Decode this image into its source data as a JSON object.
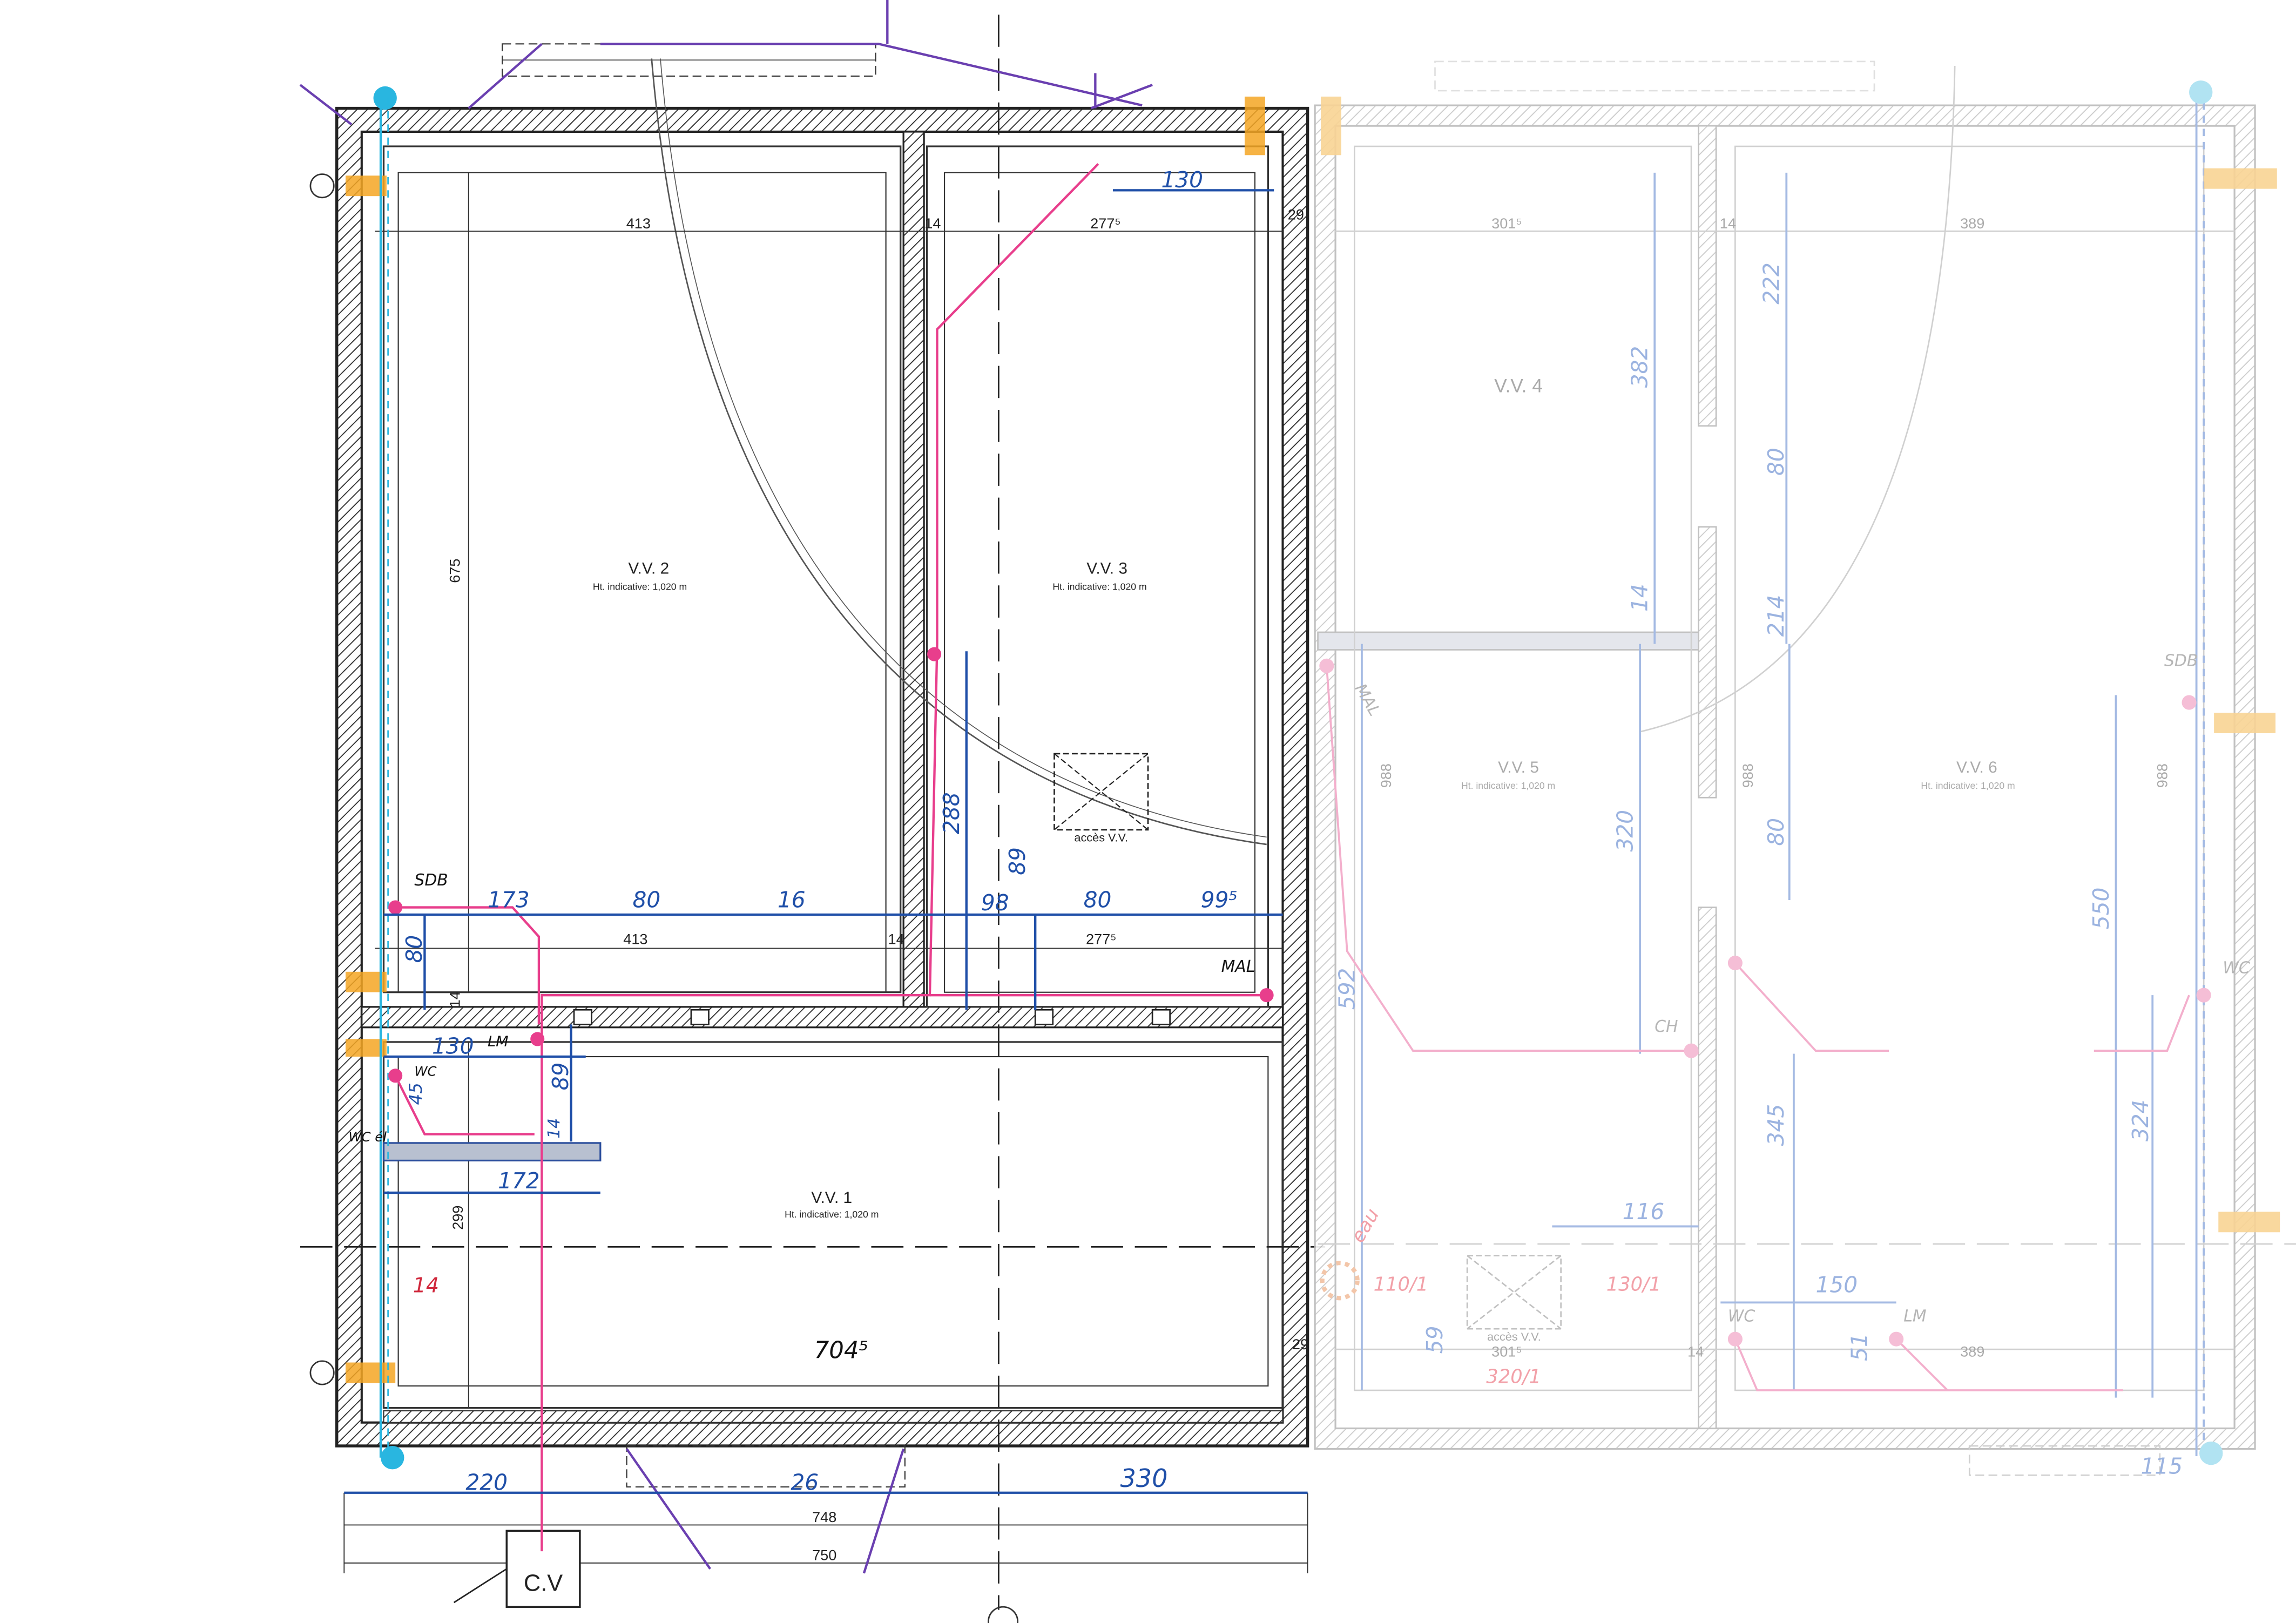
{
  "rooms": {
    "vv1": {
      "name": "V.V. 1",
      "height": "Ht. indicative: 1,020 m"
    },
    "vv2": {
      "name": "V.V. 2",
      "height": "Ht. indicative: 1,020 m"
    },
    "vv3": {
      "name": "V.V. 3",
      "height": "Ht. indicative: 1,020 m"
    },
    "vv4": {
      "name": "V.V. 4"
    },
    "vv5": {
      "name": "V.V. 5",
      "height": "Ht. indicative: 1,020 m"
    },
    "vv6": {
      "name": "V.V. 6",
      "height": "Ht. indicative: 1,020 m"
    }
  },
  "access": {
    "left": "accès V.V.",
    "right": "accès V.V."
  },
  "cv_box": "C.V",
  "print_dims": {
    "d413_top": "413",
    "d14_top": "14",
    "d2775_top": "277⁵",
    "d29_top": "29",
    "d675": "675",
    "d413_mid": "413",
    "d14_mid": "14",
    "d2775_mid": "277⁵",
    "d14_vert": "14",
    "d299": "299",
    "d29_bot": "29",
    "d748": "748",
    "d750": "750",
    "r3015": "301⁵",
    "r14": "14",
    "r389": "389",
    "r988a": "988",
    "r988b": "988",
    "r988c": "988",
    "r3015b": "301⁵",
    "r14b": "14",
    "r389b": "389"
  },
  "hand_blue": {
    "d130_top": "130",
    "d173": "173",
    "d80a": "80",
    "d16": "16",
    "d98": "98",
    "d89a": "89",
    "d80b": "80",
    "d995": "99⁵",
    "d288": "288",
    "d80v": "80",
    "d130_mid": "130",
    "d45": "45",
    "d14_wc": "14",
    "d89b": "89",
    "d172": "172",
    "d220": "220",
    "d26": "26",
    "d330": "330"
  },
  "hand_labels": {
    "sdb": "SDB",
    "mal": "MAL",
    "lm": "LM",
    "wc": "WC",
    "wc_el": "WC él",
    "r14": "14",
    "v7045": "704⁵"
  },
  "faded_blue": {
    "f222": "222",
    "f382": "382",
    "f80a": "80",
    "f214": "214",
    "f14": "14",
    "f320": "320",
    "f80b": "80",
    "f550": "550",
    "f592": "592",
    "f345": "345",
    "f324": "324",
    "f116": "116",
    "f150": "150",
    "f59": "59",
    "f51": "51",
    "f115": "115"
  },
  "faded_red": {
    "eau": "eau",
    "r110": "110/1",
    "r130": "130/1",
    "r320": "320/1",
    "ch": "CH",
    "lm": "LM",
    "wc_a": "WC",
    "wc_b": "WC",
    "mal": "MAL",
    "sdb": "SDB"
  }
}
